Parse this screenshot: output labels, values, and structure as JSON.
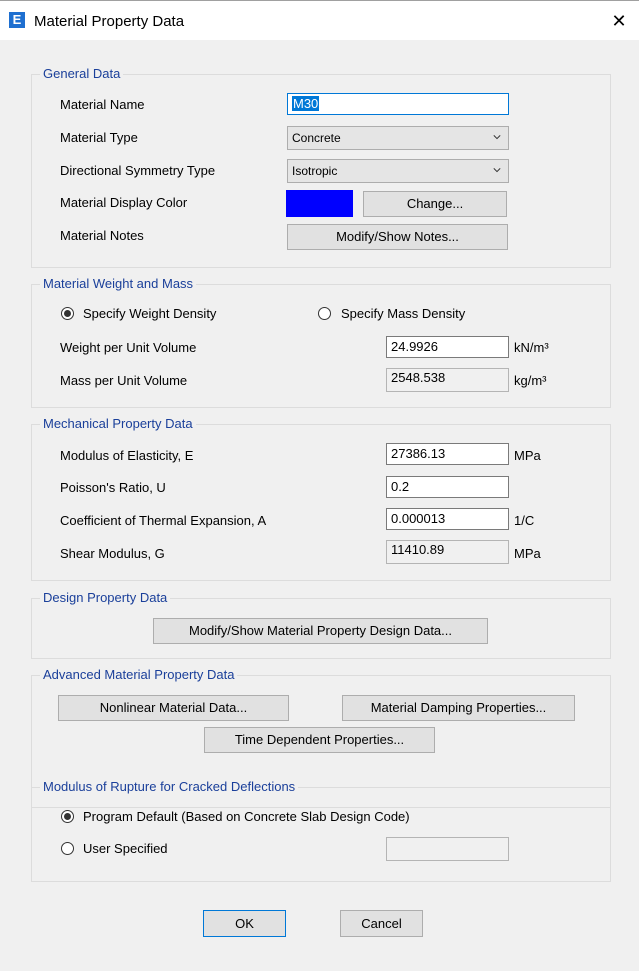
{
  "window": {
    "title": "Material Property Data",
    "icon_letter": "E",
    "close_glyph": "✕"
  },
  "general": {
    "legend": "General Data",
    "material_name_label": "Material Name",
    "material_name_value": "M30",
    "material_type_label": "Material Type",
    "material_type_value": "Concrete",
    "symmetry_label": "Directional Symmetry Type",
    "symmetry_value": "Isotropic",
    "display_color_label": "Material Display Color",
    "display_color": "#0000ff",
    "change_button": "Change...",
    "notes_label": "Material Notes",
    "notes_button": "Modify/Show Notes..."
  },
  "weight": {
    "legend": "Material Weight and Mass",
    "radio_weight": "Specify Weight Density",
    "radio_mass": "Specify Mass Density",
    "selected": "weight",
    "weight_label": "Weight per Unit Volume",
    "weight_value": "24.9926",
    "weight_unit": "kN/m³",
    "mass_label": "Mass per Unit Volume",
    "mass_value": "2548.538",
    "mass_unit": "kg/m³"
  },
  "mechanical": {
    "legend": "Mechanical Property Data",
    "e_label": "Modulus of Elasticity,  E",
    "e_value": "27386.13",
    "e_unit": "MPa",
    "u_label": "Poisson's Ratio,  U",
    "u_value": "0.2",
    "a_label": "Coefficient of Thermal Expansion,  A",
    "a_value": "0.000013",
    "a_unit": "1/C",
    "g_label": "Shear Modulus,  G",
    "g_value": "11410.89",
    "g_unit": "MPa"
  },
  "design": {
    "legend": "Design Property Data",
    "button": "Modify/Show Material Property Design Data..."
  },
  "advanced": {
    "legend": "Advanced Material Property Data",
    "nonlinear_button": "Nonlinear Material Data...",
    "damping_button": "Material Damping Properties...",
    "time_button": "Time Dependent Properties..."
  },
  "rupture": {
    "legend": "Modulus of Rupture for Cracked Deflections",
    "radio_default": "Program Default  (Based on Concrete Slab Design Code)",
    "radio_user": "User Specified",
    "selected": "default",
    "user_value": ""
  },
  "footer": {
    "ok": "OK",
    "cancel": "Cancel"
  }
}
